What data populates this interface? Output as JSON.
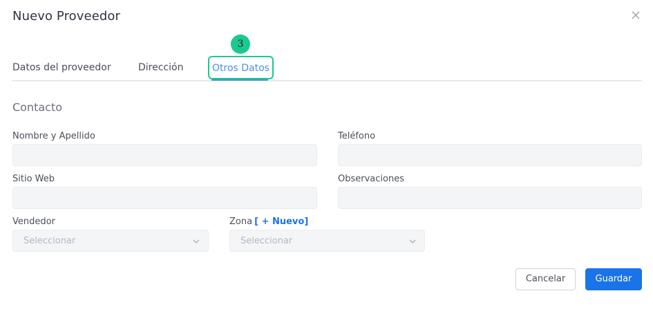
{
  "modal": {
    "title": "Nuevo Proveedor"
  },
  "tabs": [
    {
      "label": "Datos del proveedor"
    },
    {
      "label": "Dirección"
    },
    {
      "label": "Otros Datos"
    }
  ],
  "step_badge": "3",
  "section": {
    "title": "Contacto"
  },
  "fields": {
    "nombre": {
      "label": "Nombre y Apellido",
      "value": ""
    },
    "telefono": {
      "label": "Teléfono",
      "value": ""
    },
    "sitio_web": {
      "label": "Sitio Web",
      "value": ""
    },
    "observaciones": {
      "label": "Observaciones",
      "value": ""
    },
    "vendedor": {
      "label": "Vendedor",
      "placeholder": "Seleccionar"
    },
    "zona": {
      "label": "Zona",
      "new_link": "[ + Nuevo]",
      "placeholder": "Seleccionar"
    }
  },
  "buttons": {
    "cancel": "Cancelar",
    "save": "Guardar"
  },
  "colors": {
    "accent": "#1a73e8",
    "tab_active": "#4a90e2",
    "highlight": "#1bc98e"
  },
  "icons": {
    "close": "close-icon",
    "chevron": "chevron-down-icon"
  }
}
